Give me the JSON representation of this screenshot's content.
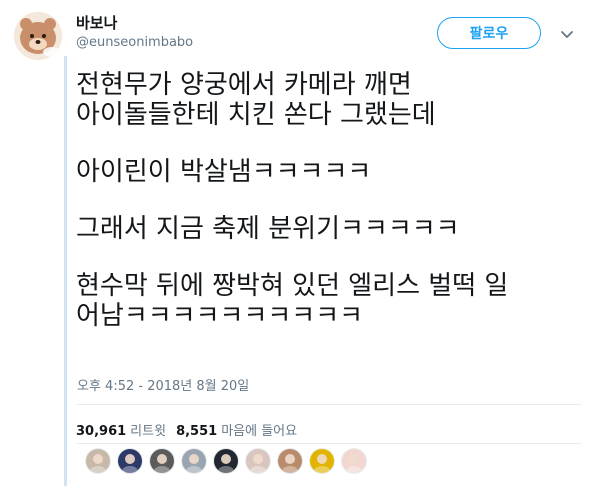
{
  "user": {
    "name": "바보나",
    "handle": "@eunseonimbabo"
  },
  "follow_button": "팔로우",
  "tweet": {
    "paragraphs": [
      "전현무가 양궁에서 카메라 깨면\n아이돌들한테 치킨 쏜다 그랬는데",
      "아이린이 박살냄ㅋㅋㅋㅋㅋ",
      "그래서 지금 축제 분위기ㅋㅋㅋㅋㅋ",
      "현수막 뒤에 짱박혀 있던 엘리스 벌떡 일\n어남ㅋㅋㅋㅋㅋㅋㅋㅋㅋㅋ"
    ],
    "timestamp": "오후 4:52 - 2018년 8월 20일"
  },
  "stats": {
    "retweets_count": "30,961",
    "retweets_label": "리트윗",
    "likes_count": "8,551",
    "likes_label": "마음에 들어요"
  },
  "liker_avatars": [
    {
      "icon": "avatar-user-1",
      "color": "#c7b8a8"
    },
    {
      "icon": "avatar-user-2",
      "color": "#2b3a67"
    },
    {
      "icon": "avatar-user-3",
      "color": "#5b5b5b"
    },
    {
      "icon": "avatar-user-4",
      "color": "#9aa5b1"
    },
    {
      "icon": "avatar-user-5",
      "color": "#222831"
    },
    {
      "icon": "avatar-user-6",
      "color": "#d9c7bf"
    },
    {
      "icon": "avatar-user-7",
      "color": "#b88b6a"
    },
    {
      "icon": "avatar-user-8",
      "color": "#e0b400"
    },
    {
      "icon": "avatar-user-9",
      "color": "#f3d6cf"
    }
  ],
  "colors": {
    "accent": "#1da1f2",
    "text": "#14171a",
    "muted": "#657786"
  }
}
